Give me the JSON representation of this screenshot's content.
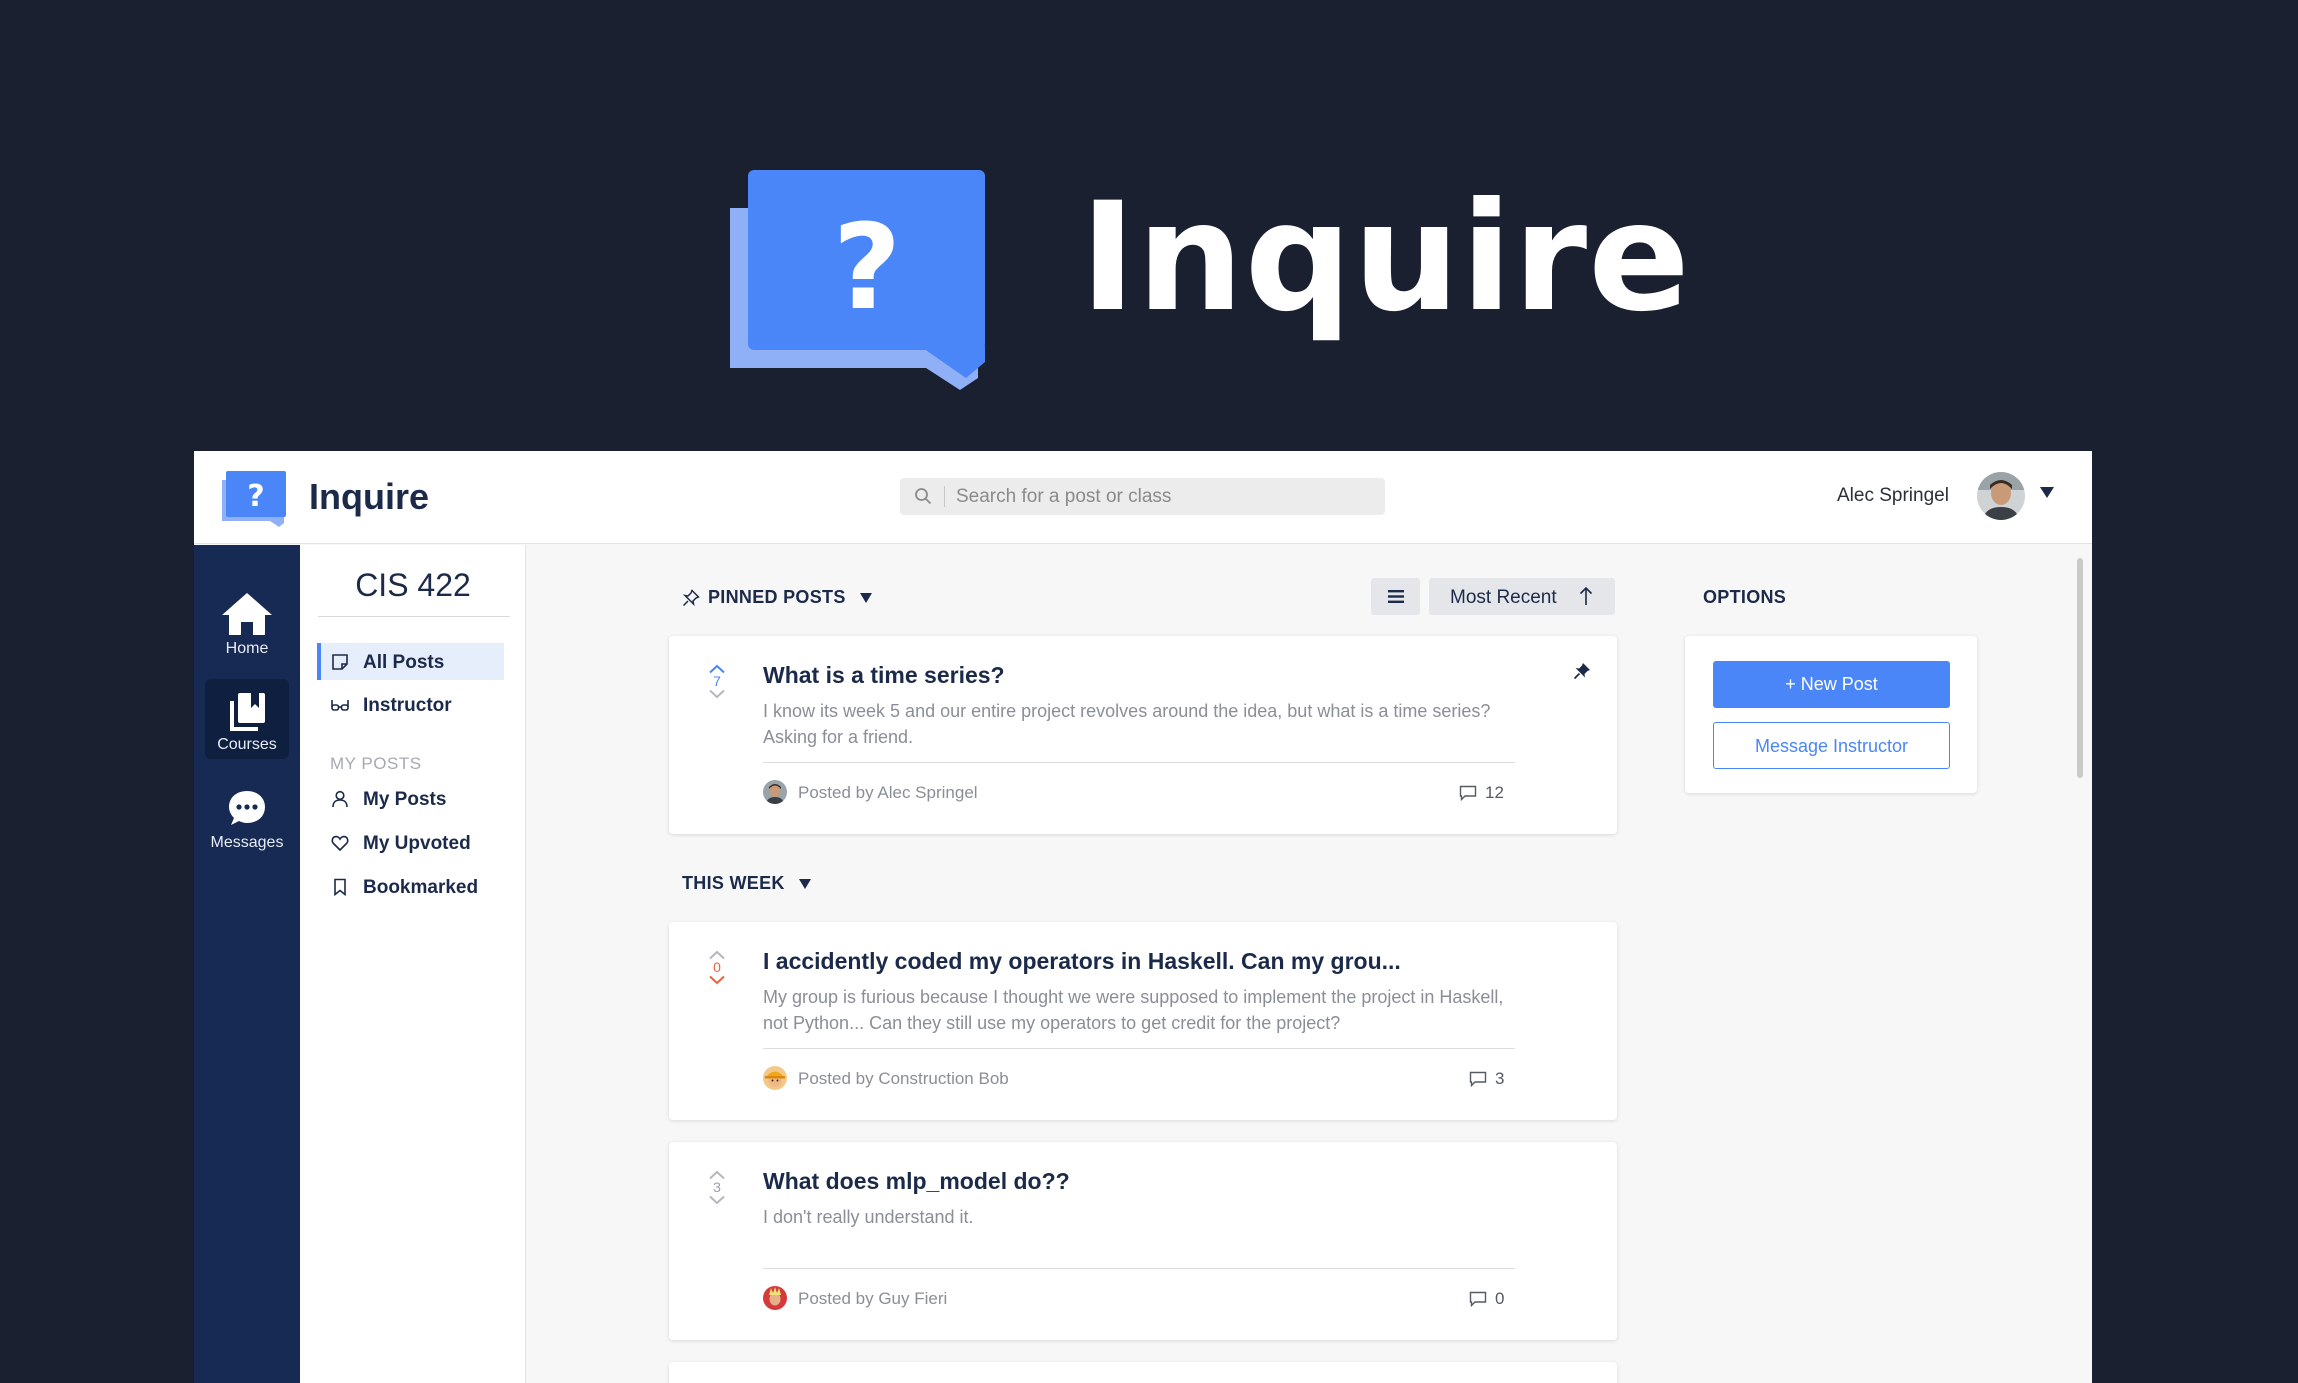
{
  "hero": {
    "title": "Inquire"
  },
  "topbar": {
    "brand": "Inquire",
    "search": {
      "placeholder": "Search for a post or class"
    },
    "user_name": "Alec Springel"
  },
  "rail": {
    "items": [
      {
        "label": "Home",
        "icon": "home-icon"
      },
      {
        "label": "Courses",
        "icon": "courses-icon",
        "active": true
      },
      {
        "label": "Messages",
        "icon": "messages-icon"
      }
    ]
  },
  "course": {
    "title": "CIS 422",
    "nav": [
      {
        "label": "All Posts",
        "icon": "document-icon",
        "active": true
      },
      {
        "label": "Instructor",
        "icon": "glasses-icon"
      }
    ],
    "my_posts_section": "MY POSTS",
    "my_posts": [
      {
        "label": "My Posts",
        "icon": "user-icon"
      },
      {
        "label": "My Upvoted",
        "icon": "heart-icon"
      },
      {
        "label": "Bookmarked",
        "icon": "bookmark-icon"
      }
    ]
  },
  "feed": {
    "pinned_heading": "PINNED POSTS",
    "sort_label": "Most Recent",
    "this_week_heading": "THIS WEEK",
    "pinned": [
      {
        "votes": "7",
        "title": "What is a time series?",
        "body": "I know its week 5 and our entire project revolves around the idea, but what is a time series? Asking for a friend.",
        "author": "Posted by Alec Springel",
        "comments": "12"
      }
    ],
    "posts": [
      {
        "votes": "0",
        "title": "I accidently coded my operators in Haskell. Can my grou...",
        "body": "My group is furious because I thought we were supposed to implement the project in Haskell, not Python... Can they still use my operators to get credit for the project?",
        "author": "Posted by Construction Bob",
        "comments": "3"
      },
      {
        "votes": "3",
        "title": "What does mlp_model do??",
        "body": "I don't really understand it.",
        "author": "Posted by Guy Fieri",
        "comments": "0"
      }
    ]
  },
  "options": {
    "heading": "OPTIONS",
    "new_post": "+ New Post",
    "message_instructor": "Message Instructor"
  },
  "colors": {
    "background": "#1b2030",
    "accent": "#4a86f7",
    "navy": "#172a54",
    "downvote": "#e8643c"
  }
}
